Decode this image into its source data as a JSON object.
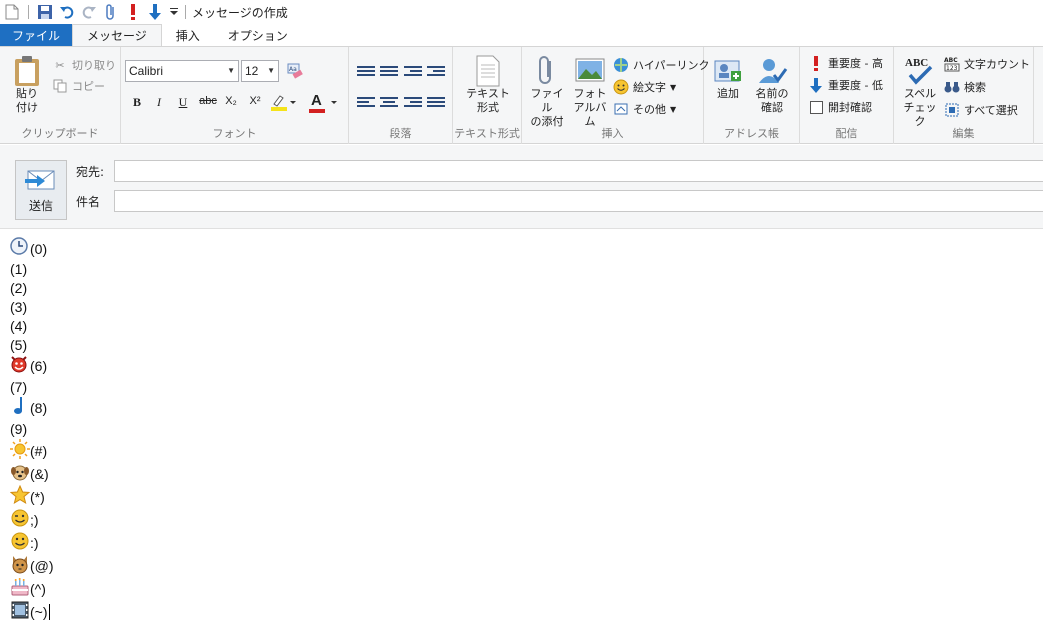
{
  "window": {
    "title": "メッセージの作成"
  },
  "tabs": [
    "ファイル",
    "メッセージ",
    "挿入",
    "オプション"
  ],
  "clipboard": {
    "paste": "貼り\n付け",
    "cut": "切り取り",
    "copy": "コピー",
    "label": "クリップボード"
  },
  "font": {
    "family": "Calibri",
    "size": "12",
    "label": "フォント",
    "bold": "B",
    "italic": "I",
    "underline": "U",
    "strike": "abc",
    "subscript": "X₂",
    "superscript": "X²",
    "color_letter": "A"
  },
  "paragraph": {
    "label": "段落"
  },
  "textformat": {
    "button": "テキスト\n形式",
    "label": "テキスト形式"
  },
  "insert": {
    "attach": "ファイル\nの添付",
    "album": "フォト\nアルバム",
    "hyperlink": "ハイパーリンク",
    "emoji": "絵文字",
    "other": "その他",
    "label": "挿入"
  },
  "addressbook": {
    "add": "追加",
    "check_names": "名前の\n確認",
    "label": "アドレス帳"
  },
  "delivery": {
    "high": "重要度 - 高",
    "low": "重要度 - 低",
    "read_receipt": "開封確認",
    "label": "配信"
  },
  "editing": {
    "spell": "スペル\nチェック",
    "word_count": "文字カウント",
    "find": "検索",
    "select_all": "すべて選択",
    "label": "編集"
  },
  "compose": {
    "send": "送信",
    "to_label": "宛先:",
    "subject_label": "件名",
    "to_value": "",
    "subject_value": ""
  },
  "body_lines": [
    {
      "icon": "clock-emoji-icon",
      "text": "(0)"
    },
    {
      "icon": "",
      "text": "(1)"
    },
    {
      "icon": "",
      "text": "(2)"
    },
    {
      "icon": "",
      "text": "(3)"
    },
    {
      "icon": "",
      "text": "(4)"
    },
    {
      "icon": "",
      "text": "(5)"
    },
    {
      "icon": "devil-emoji-icon",
      "text": "(6)"
    },
    {
      "icon": "",
      "text": "(7)"
    },
    {
      "icon": "music-note-emoji-icon",
      "text": "(8)"
    },
    {
      "icon": "",
      "text": "(9)"
    },
    {
      "icon": "sun-emoji-icon",
      "text": "(#)"
    },
    {
      "icon": "dog-emoji-icon",
      "text": "(&)"
    },
    {
      "icon": "star-emoji-icon",
      "text": "(*)"
    },
    {
      "icon": "wink-emoji-icon",
      "text": ";)"
    },
    {
      "icon": "smile-emoji-icon",
      "text": ":)"
    },
    {
      "icon": "cat-emoji-icon",
      "text": "(@)"
    },
    {
      "icon": "cake-emoji-icon",
      "text": "(^)"
    },
    {
      "icon": "film-emoji-icon",
      "text": "(~)"
    }
  ],
  "colors": {
    "file_tab": "#1e6fc2",
    "ribbon_bg": "#f5f6f7",
    "importance_red": "#d32020",
    "arrow_blue": "#1f6fc0"
  }
}
